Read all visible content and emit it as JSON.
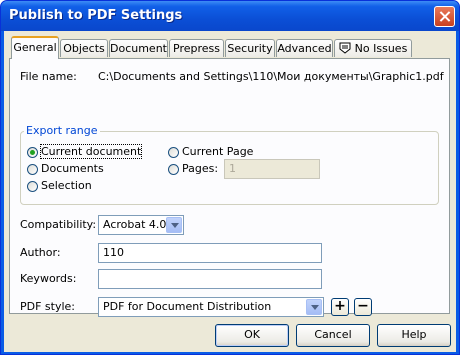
{
  "window": {
    "title": "Publish to PDF Settings"
  },
  "tabs": [
    {
      "label": "General"
    },
    {
      "label": "Objects"
    },
    {
      "label": "Document"
    },
    {
      "label": "Prepress"
    },
    {
      "label": "Security"
    },
    {
      "label": "Advanced"
    },
    {
      "label": "No Issues",
      "icon": "issues-icon"
    }
  ],
  "general": {
    "file_name_label": "File name:",
    "file_name_value": "C:\\Documents and Settings\\110\\Мои документы\\Graphic1.pdf",
    "export_range": {
      "title": "Export range",
      "options": [
        {
          "label": "Current document",
          "selected": true
        },
        {
          "label": "Documents",
          "selected": false
        },
        {
          "label": "Selection",
          "selected": false
        },
        {
          "label": "Current Page",
          "selected": false
        },
        {
          "label": "Pages:",
          "selected": false
        }
      ],
      "pages_value": "1"
    },
    "compatibility_label": "Compatibility:",
    "compatibility_value": "Acrobat 4.0",
    "author_label": "Author:",
    "author_value": "110",
    "keywords_label": "Keywords:",
    "keywords_value": "",
    "pdf_style_label": "PDF style:",
    "pdf_style_value": "PDF for Document Distribution",
    "add_style": "+",
    "remove_style": "−"
  },
  "buttons": {
    "ok": "OK",
    "cancel": "Cancel",
    "help": "Help"
  },
  "colors": {
    "title_bar": "#0a5ce6",
    "group_title": "#0046d5",
    "radio_selected": "#21a121"
  }
}
